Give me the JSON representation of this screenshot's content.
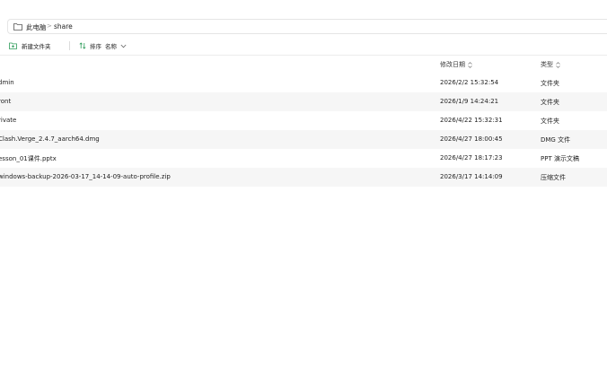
{
  "breadcrumb": {
    "root": "此电脑",
    "separator": ">",
    "current": "share"
  },
  "toolbar": {
    "new_folder_label": "新建文件夹",
    "sort_label": "排序",
    "sort_value": "名称"
  },
  "columns": {
    "name": "\u0000",
    "date_modified": "修改日期",
    "type": "类型"
  },
  "files": [
    {
      "name": "dmin",
      "date": "2026/2/2 15:32:54",
      "type": "文件夹"
    },
    {
      "name": "ront",
      "date": "2026/1/9 14:24:21",
      "type": "文件夹"
    },
    {
      "name": "rivate",
      "date": "2026/4/22 15:32:31",
      "type": "文件夹"
    },
    {
      "name": "Clash.Verge_2.4.7_aarch64.dmg",
      "date": "2026/4/27 18:00:45",
      "type": "DMG 文件"
    },
    {
      "name": "esson_01课件.pptx",
      "date": "2026/4/27 18:17:23",
      "type": "PPT 演示文稿"
    },
    {
      "name": "windows-backup-2026-03-17_14-14-09-auto-profile.zip",
      "date": "2026/3/17 14:14:09",
      "type": "压缩文件"
    }
  ],
  "colors": {
    "accent_green": "#2e9c5a",
    "row_alt": "#f6f6f6",
    "border": "#e5e5e5"
  }
}
